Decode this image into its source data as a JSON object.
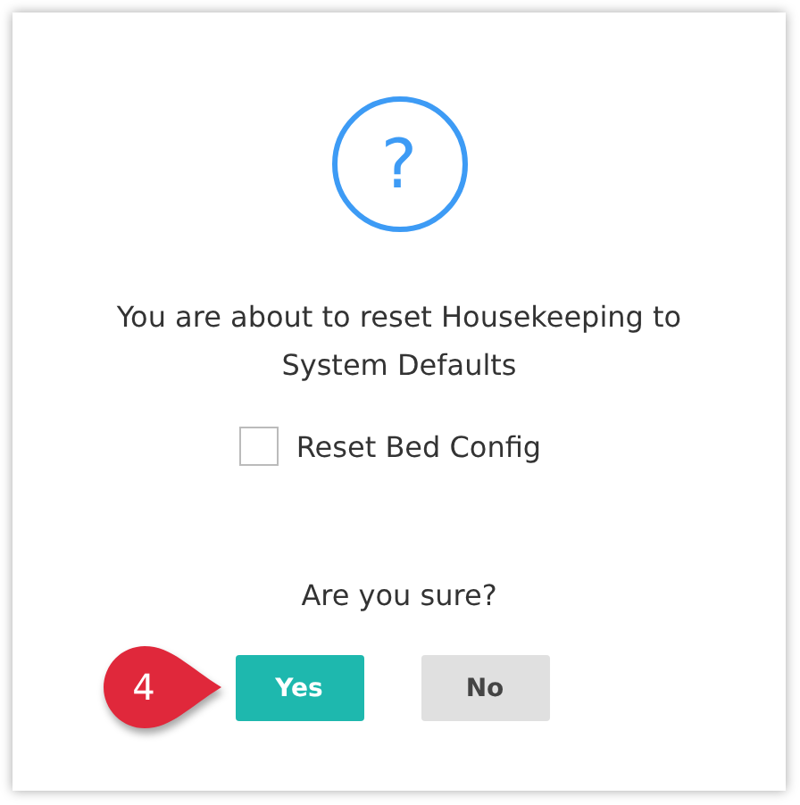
{
  "dialog": {
    "icon_text": "?",
    "message": "You are about to reset Housekeeping to System Defaults",
    "checkbox": {
      "label": "Reset Bed Config",
      "checked": false
    },
    "question": "Are you sure?",
    "buttons": [
      {
        "label": "Yes",
        "kind": "primary"
      },
      {
        "label": "No",
        "kind": "secondary"
      }
    ],
    "callout": {
      "text": "4"
    }
  }
}
